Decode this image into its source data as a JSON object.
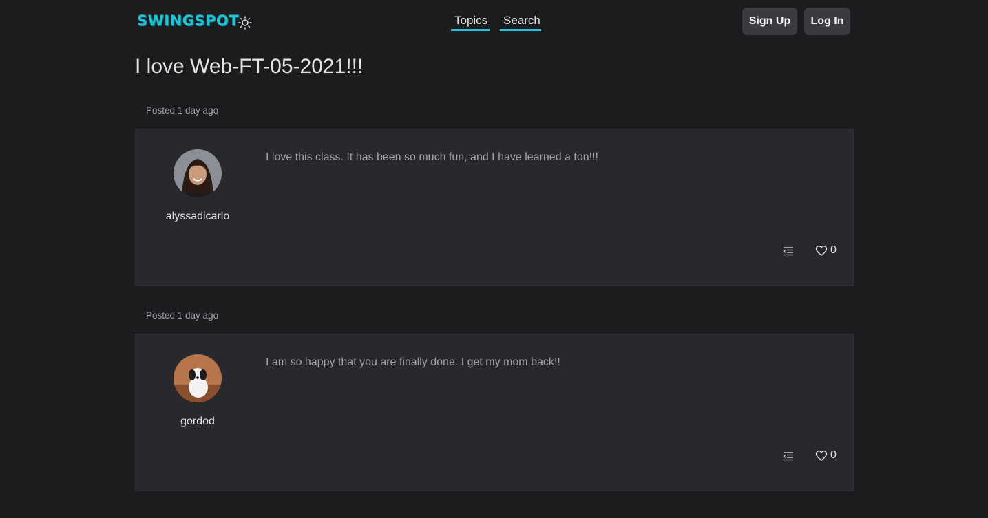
{
  "header": {
    "logo": "SWINGSPOT",
    "theme_icon": "sun-icon",
    "nav": [
      {
        "label": "Topics"
      },
      {
        "label": "Search"
      }
    ],
    "sign_up_label": "Sign Up",
    "log_in_label": "Log In"
  },
  "topic": {
    "title": "I love Web-FT-05-2021!!!"
  },
  "posts": [
    {
      "posted": "Posted 1 day ago",
      "username": "alyssadicarlo",
      "body": "I love this class. It has been so much fun, and I have learned a ton!!!",
      "likes": "0",
      "reply_icon": "reply-icon",
      "like_icon": "heart-icon"
    },
    {
      "posted": "Posted 1 day ago",
      "username": "gordod",
      "body": "I am so happy that you are finally done. I get my mom back!!",
      "likes": "0",
      "reply_icon": "reply-icon",
      "like_icon": "heart-icon"
    }
  ],
  "colors": {
    "background": "#1c1c1f",
    "card": "#29292d",
    "accent": "#22c1d3",
    "button": "#3b3b3f"
  }
}
